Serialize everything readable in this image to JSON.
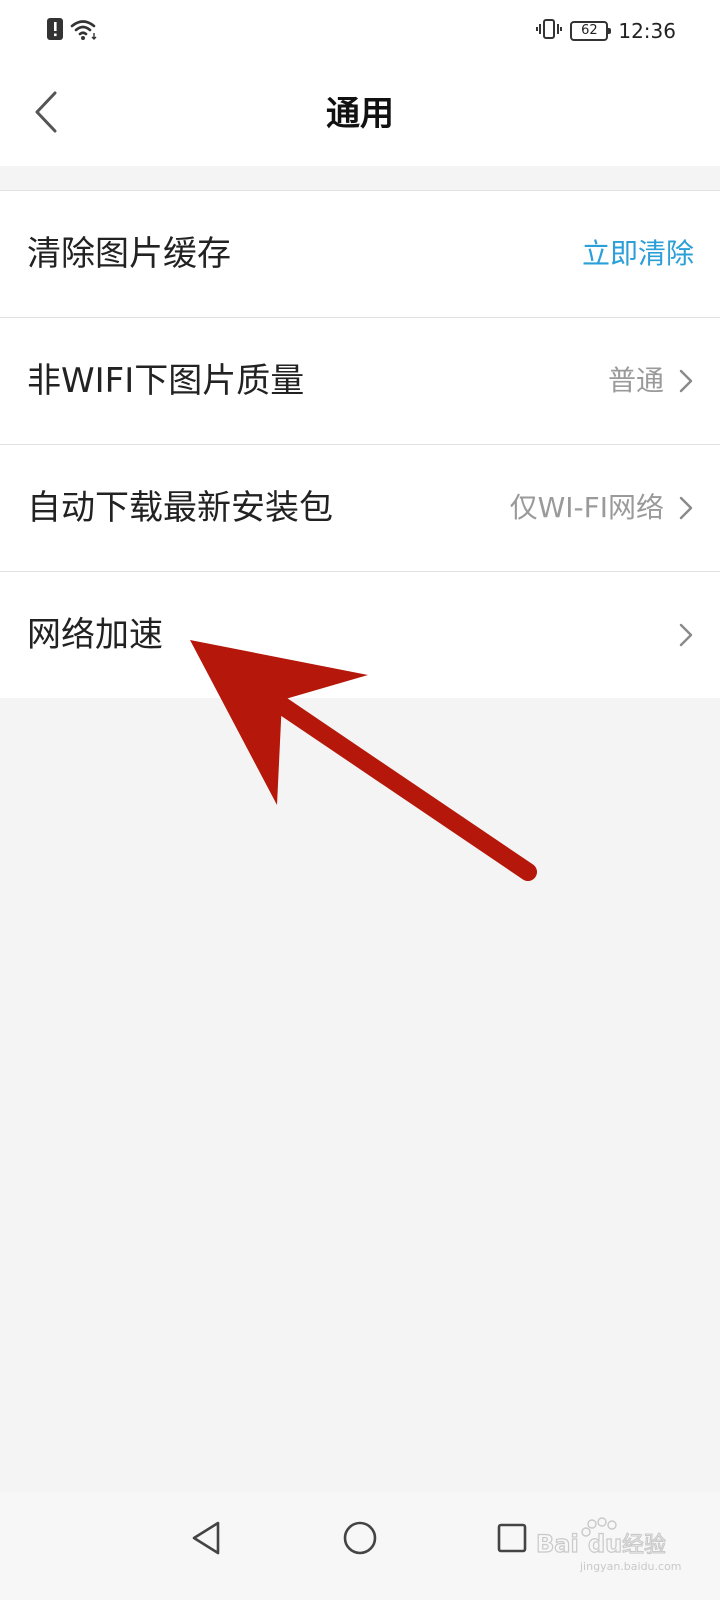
{
  "status_bar": {
    "time": "12:36",
    "battery_level": "62",
    "icons": {
      "left": [
        "alert-icon",
        "wifi-icon"
      ],
      "right": [
        "vibrate-icon",
        "battery-icon"
      ]
    }
  },
  "header": {
    "title": "通用",
    "back_icon": "chevron-left-icon"
  },
  "settings": {
    "rows": [
      {
        "label": "清除图片缓存",
        "action": "立即清除"
      },
      {
        "label": "非WIFI下图片质量",
        "value": "普通",
        "chevron": "chevron-right-icon"
      },
      {
        "label": "自动下载最新安装包",
        "value": "仅WI-FI网络",
        "chevron": "chevron-right-icon"
      },
      {
        "label": "网络加速",
        "chevron": "chevron-right-icon"
      }
    ]
  },
  "nav_bar": {
    "icons": [
      "back-triangle-icon",
      "home-circle-icon",
      "recents-square-icon"
    ]
  },
  "colors": {
    "accent": "#2a9fd8",
    "annotation_arrow": "#b5170a",
    "page_background": "#f4f4f4"
  },
  "watermark": {
    "text": "Baidu经验",
    "url_text": "jingyan.baidu.com"
  }
}
